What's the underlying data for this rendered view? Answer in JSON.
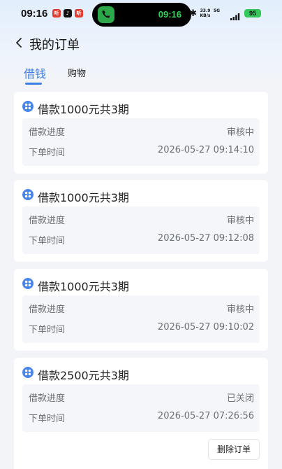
{
  "status_bar": {
    "time": "09:16",
    "call_time": "09:16",
    "app_icons": [
      "notification-icon",
      "tiktok-icon",
      "notification-icon"
    ],
    "app_icon_glyphs": [
      "听",
      "♪",
      "听"
    ],
    "network_speed": "33.9 KB/s",
    "network_type": "5G",
    "battery": "95"
  },
  "header": {
    "title": "我的订单"
  },
  "tabs": [
    {
      "label": "借钱",
      "active": true
    },
    {
      "label": "购物",
      "active": false
    }
  ],
  "orders": [
    {
      "title": "借款1000元共3期",
      "progress_label": "借款进度",
      "progress_value": "审核中",
      "time_label": "下单时间",
      "time_value": "2026-05-27 09:14:10"
    },
    {
      "title": "借款1000元共3期",
      "progress_label": "借款进度",
      "progress_value": "审核中",
      "time_label": "下单时间",
      "time_value": "2026-05-27 09:12:08"
    },
    {
      "title": "借款1000元共3期",
      "progress_label": "借款进度",
      "progress_value": "审核中",
      "time_label": "下单时间",
      "time_value": "2026-05-27 09:10:02"
    },
    {
      "title": "借款2500元共3期",
      "progress_label": "借款进度",
      "progress_value": "已关闭",
      "time_label": "下单时间",
      "time_value": "2026-05-27 07:26:56",
      "action_label": "删除订单"
    }
  ],
  "colors": {
    "accent": "#3d7ee6",
    "background": "#f3f4f7"
  }
}
